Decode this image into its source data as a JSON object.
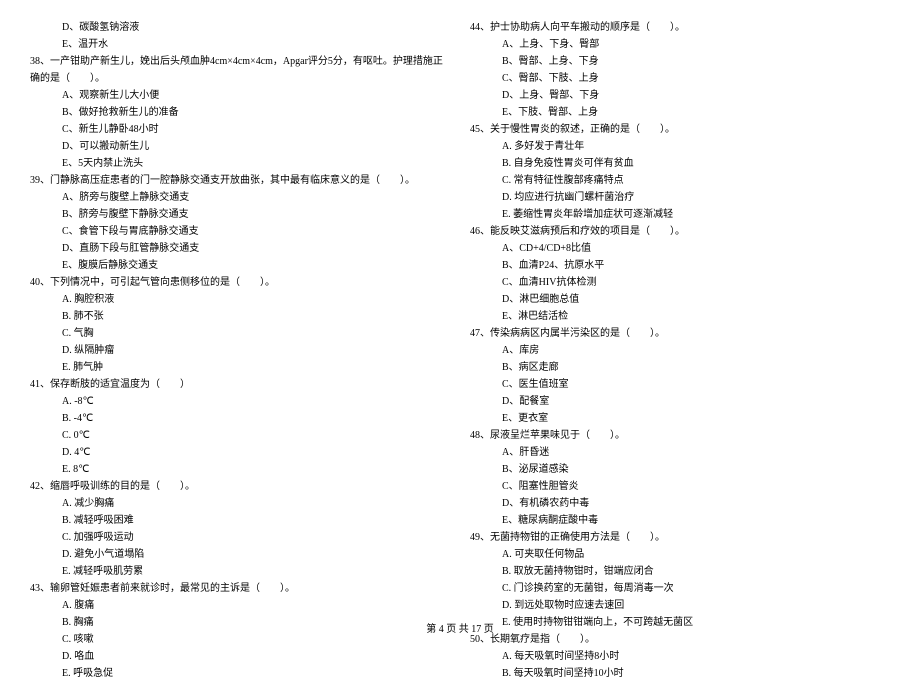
{
  "left_column": {
    "pre_options": [
      "D、碳酸氢钠溶液",
      "E、温开水"
    ],
    "questions": [
      {
        "number": "38、",
        "text": "一产钳助产新生儿，娩出后头颅血肿4cm×4cm×4cm，Apgar评分5分，有呕吐。护理措施正",
        "continuation": "确的是（　　）。",
        "options": [
          "A、观察新生儿大小便",
          "B、做好抢救新生儿的准备",
          "C、新生儿静卧48小时",
          "D、可以搬动新生儿",
          "E、5天内禁止洗头"
        ]
      },
      {
        "number": "39、",
        "text": "门静脉高压症患者的门一腔静脉交通支开放曲张，其中最有临床意义的是（　　）。",
        "options": [
          "A、脐旁与腹壁上静脉交通支",
          "B、脐旁与腹壁下静脉交通支",
          "C、食管下段与胃底静脉交通支",
          "D、直肠下段与肛管静脉交通支",
          "E、腹膜后静脉交通支"
        ]
      },
      {
        "number": "40、",
        "text": "下列情况中，可引起气管向患侧移位的是（　　）。",
        "options": [
          "A. 胸腔积液",
          "B. 肺不张",
          "C. 气胸",
          "D. 纵隔肿瘤",
          "E. 肺气肿"
        ]
      },
      {
        "number": "41、",
        "text": "保存断肢的适宜温度为（　　）",
        "options": [
          "A. -8℃",
          "B. -4℃",
          "C. 0℃",
          "D. 4℃",
          "E. 8℃"
        ]
      },
      {
        "number": "42、",
        "text": "缩唇呼吸训练的目的是（　　）。",
        "options": [
          "A. 减少胸痛",
          "B. 减轻呼吸困难",
          "C. 加强呼吸运动",
          "D. 避免小气道塌陷",
          "E. 减轻呼吸肌劳累"
        ]
      },
      {
        "number": "43、",
        "text": "输卵管妊娠患者前来就诊时，最常见的主诉是（　　）。",
        "options": [
          "A. 腹痛",
          "B. 胸痛",
          "C. 咳嗽",
          "D. 咯血",
          "E. 呼吸急促"
        ]
      }
    ]
  },
  "right_column": {
    "questions": [
      {
        "number": "44、",
        "text": "护士协助病人向平车搬动的顺序是（　　）。",
        "options": [
          "A、上身、下身、臀部",
          "B、臀部、上身、下身",
          "C、臀部、下肢、上身",
          "D、上身、臀部、下身",
          "E、下肢、臀部、上身"
        ]
      },
      {
        "number": "45、",
        "text": "关于慢性胃炎的叙述，正确的是（　　）。",
        "options": [
          "A. 多好发于青壮年",
          "B. 自身免疫性胃炎可伴有贫血",
          "C. 常有特征性腹部疼痛特点",
          "D. 均应进行抗幽门螺杆菌治疗",
          "E. 萎缩性胃炎年龄增加症状可逐渐减轻"
        ]
      },
      {
        "number": "46、",
        "text": "能反映艾滋病预后和疗效的项目是（　　）。",
        "options": [
          "A、CD+4/CD+8比值",
          "B、血清P24、抗原水平",
          "C、血清HIV抗体检测",
          "D、淋巴细胞总值",
          "E、淋巴结活检"
        ]
      },
      {
        "number": "47、",
        "text": "传染病病区内属半污染区的是（　　）。",
        "options": [
          "A、库房",
          "B、病区走廊",
          "C、医生值班室",
          "D、配餐室",
          "E、更衣室"
        ]
      },
      {
        "number": "48、",
        "text": "尿液呈烂苹果味见于（　　）。",
        "options": [
          "A、肝昏迷",
          "B、泌尿道感染",
          "C、阻塞性胆管炎",
          "D、有机磷农药中毒",
          "E、糖尿病酮症酸中毒"
        ]
      },
      {
        "number": "49、",
        "text": "无菌持物钳的正确使用方法是（　　）。",
        "options": [
          "A. 可夹取任何物品",
          "B. 取放无菌持物钳时，钳端应闭合",
          "C. 门诊换药室的无菌钳，每周消毒一次",
          "D. 到远处取物时应速去速回",
          "E. 使用时持物钳钳端向上，不可跨越无菌区"
        ]
      },
      {
        "number": "50、",
        "text": "长期氧疗是指（　　）。",
        "options": [
          "A. 每天吸氧时间坚持8小时",
          "B. 每天吸氧时间坚持10小时"
        ]
      }
    ]
  },
  "footer": "第 4 页 共 17 页"
}
